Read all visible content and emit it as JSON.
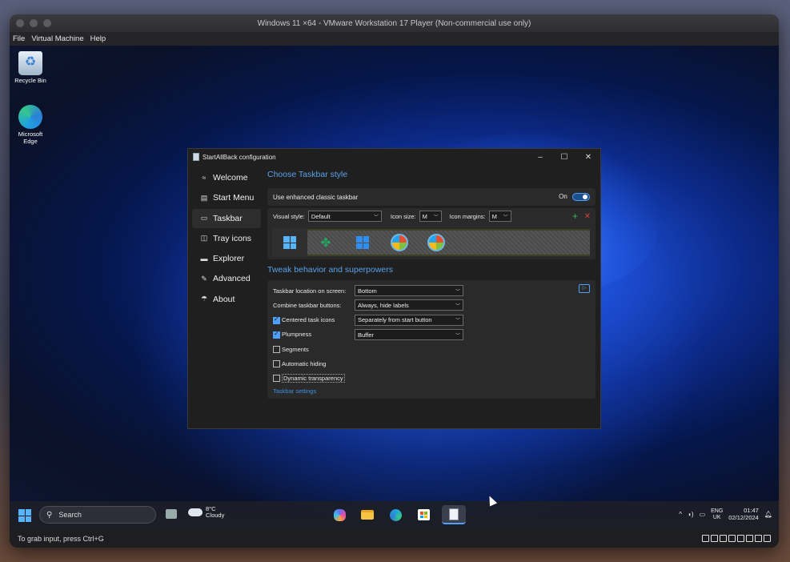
{
  "vm": {
    "title": "Windows 11 ×64 - VMware Workstation 17 Player (Non-commercial use only)",
    "menu": [
      "File",
      "Virtual Machine",
      "Help"
    ],
    "status_hint": "To grab input, press Ctrl+G"
  },
  "desktop": {
    "icons": [
      {
        "label": "Recycle Bin",
        "icon": "recycle-bin-icon"
      },
      {
        "label": "Microsoft Edge",
        "icon": "edge-icon"
      }
    ]
  },
  "sab": {
    "title": "StartAllBack configuration",
    "window_controls": {
      "minimize": "–",
      "maximize": "☐",
      "close": "✕"
    },
    "nav": [
      {
        "label": "Welcome",
        "icon": "≈"
      },
      {
        "label": "Start Menu",
        "icon": "▤"
      },
      {
        "label": "Taskbar",
        "icon": "▭"
      },
      {
        "label": "Tray icons",
        "icon": "◫"
      },
      {
        "label": "Explorer",
        "icon": "▬"
      },
      {
        "label": "Advanced",
        "icon": "✎"
      },
      {
        "label": "About",
        "icon": "☂"
      }
    ],
    "active_nav": "Taskbar",
    "style_section": {
      "title": "Choose Taskbar style",
      "enhanced_label": "Use enhanced classic taskbar",
      "enhanced_state": "On",
      "visual_style_label": "Visual style:",
      "visual_style_value": "Default",
      "icon_size_label": "Icon size:",
      "icon_size_value": "M",
      "icon_margins_label": "Icon margins:",
      "icon_margins_value": "M",
      "add_symbol": "+",
      "remove_symbol": "✕"
    },
    "behavior_section": {
      "title": "Tweak behavior and superpowers",
      "location_label": "Taskbar location on screen:",
      "location_value": "Bottom",
      "combine_label": "Combine taskbar buttons:",
      "combine_value": "Always, hide labels",
      "centered_label": "Centered task icons",
      "centered_checked": true,
      "centered_value": "Separately from start button",
      "plumpness_label": "Plumpness",
      "plumpness_checked": true,
      "plumpness_value": "Buffer",
      "segments_label": "Segments",
      "auto_hide_label": "Automatic hiding",
      "dynamic_label": "Dynamic transparency",
      "settings_link": "Taskbar settings"
    }
  },
  "taskbar": {
    "search_placeholder": "Search",
    "weather_temp": "8°C",
    "weather_desc": "Cloudy",
    "lang_top": "ENG",
    "lang_bottom": "UK",
    "time": "01:47",
    "date": "02/12/2024"
  },
  "colors": {
    "accent": "#4ea1ff",
    "section_title": "#5aa0e8",
    "link": "#3d8ee0"
  }
}
